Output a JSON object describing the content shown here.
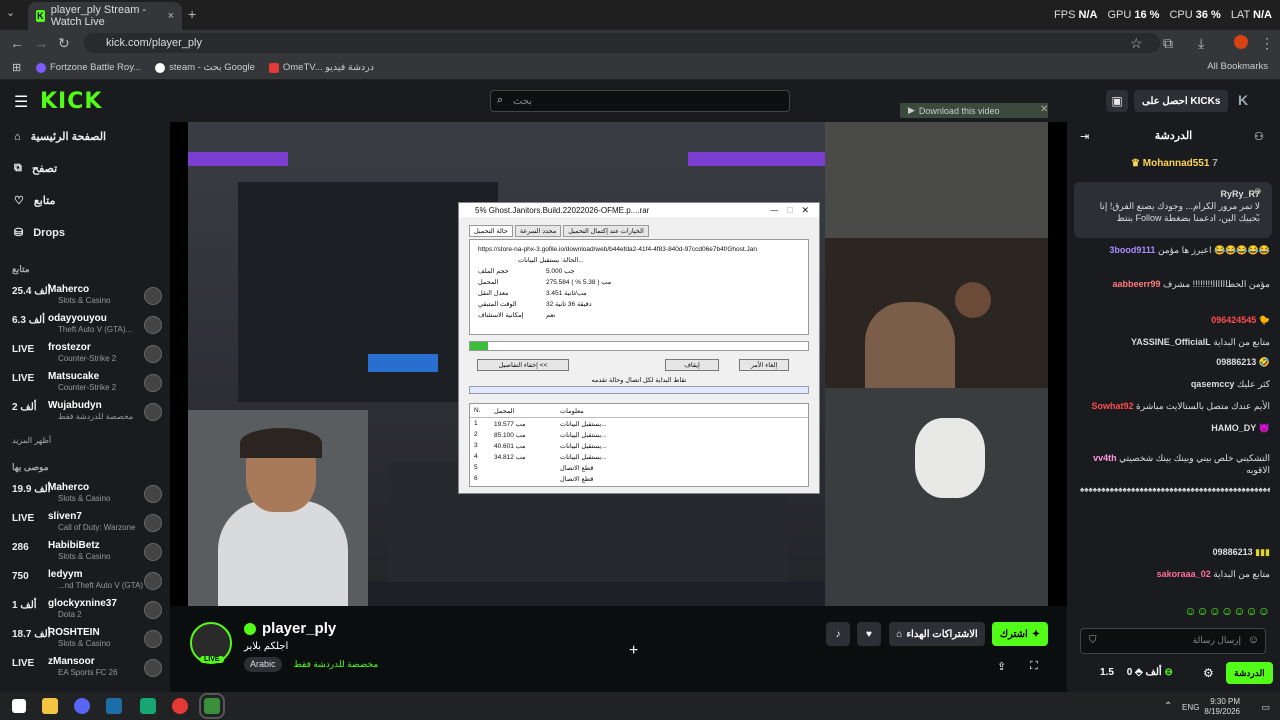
{
  "browser": {
    "tab_title": "player_ply Stream - Watch Live",
    "tab_close": "×",
    "new_tab": "+",
    "url": "kick.com/player_ply",
    "bookmarks": [
      {
        "label": "Fortzone Battle Roy...",
        "color": "#7b5cff"
      },
      {
        "label": "steam - بحث Google",
        "color": "#ffffff"
      },
      {
        "label": "OmeTV... دردشة فيديو",
        "color": "#e53935"
      }
    ],
    "all_bookmarks": "All Bookmarks"
  },
  "overlay": {
    "fps_label": "FPS",
    "fps_value": "N/A",
    "gpu_label": "GPU",
    "gpu_value": "16 %",
    "cpu_label": "CPU",
    "cpu_value": "36 %",
    "lat_label": "LAT",
    "lat_value": "N/A"
  },
  "header": {
    "logo": "KICK",
    "search_placeholder": "بحث",
    "get_kicks": "احصل على KICKs"
  },
  "sidebar": {
    "nav": [
      {
        "label": "الصفحة الرئيسية",
        "icon": "home-icon"
      },
      {
        "label": "تصفح",
        "icon": "browse-icon"
      },
      {
        "label": "متابع",
        "icon": "heart-icon"
      },
      {
        "label": "Drops",
        "icon": "drops-icon"
      }
    ],
    "following_header": "متابع",
    "following": [
      {
        "viewers": "25.4 ألف",
        "name": "Maherco",
        "category": "Slots & Casino"
      },
      {
        "viewers": "6.3 ألف",
        "name": "odayyouyou",
        "category": "Theft Auto V (GTA)..."
      },
      {
        "viewers": "LIVE",
        "name": "frostezor",
        "category": "Counter-Strike 2"
      },
      {
        "viewers": "LIVE",
        "name": "Matsucake",
        "category": "Counter-Strike 2"
      },
      {
        "viewers": "2 ألف",
        "name": "Wujabudyn",
        "category": "مخصصة للدردشة فقط"
      }
    ],
    "show_more": "أظهر المزيد",
    "recommended_header": "موصى بها",
    "recommended": [
      {
        "viewers": "19.9 ألف",
        "name": "Maherco",
        "category": "Slots & Casino"
      },
      {
        "viewers": "LIVE",
        "name": "sliven7",
        "category": "Call of Duty: Warzone"
      },
      {
        "viewers": "286",
        "name": "HabibiBetz",
        "category": "Slots & Casino"
      },
      {
        "viewers": "750",
        "name": "ledyym",
        "category": "...nd Theft Auto V (GTA)"
      },
      {
        "viewers": "1 ألف",
        "name": "glockyxnine37",
        "category": "Dota 2"
      },
      {
        "viewers": "18.7 ألف",
        "name": "ROSHTEIN",
        "category": "Slots & Casino"
      },
      {
        "viewers": "LIVE",
        "name": "zMansoor",
        "category": "EA Sports FC 26"
      }
    ]
  },
  "video": {
    "download_bar": "Download this video",
    "idm": {
      "title": "5% Ghost.Janitors.Build.22022026-OFME.p....rar",
      "tabs": [
        "حالة التحميل",
        "محدد السرعة",
        "الخيارات عند إكتمال التحميل"
      ],
      "url": "https://store-na-phx-3.gofile.io/download/web/b44efda2-41f4-4f83-840d-97ccd06e7b4f/Ghost.Jan",
      "status_label": "الحالة:",
      "status_value": "يستقبل البيانات...",
      "rows": [
        {
          "label": "حجم الملف",
          "value": "5.000 جب"
        },
        {
          "label": "المحمل",
          "value": "275.584 مب ( 5.38 % )"
        },
        {
          "label": "معدل النقل",
          "value": "3.451 مب/ثانية"
        },
        {
          "label": "الوقت المتبقي",
          "value": "32 دقيقة 36 ثانية"
        },
        {
          "label": "إمكانية الاستئناف",
          "value": "نعم"
        }
      ],
      "progress_percent": 5.38,
      "btn_hide": "إخفاء التفاصيل <<",
      "btn_pause": "إيقاف",
      "btn_cancel": "إلغاء الأمر",
      "segments_label": "نقاط البداية لكل اتصال وحالة تقدمه",
      "grid_headers": [
        "N.",
        "المحمل",
        "معلومات"
      ],
      "grid_rows": [
        [
          "1",
          "19.577 مب",
          "يستقبل البيانات..."
        ],
        [
          "2",
          "85.100 مب",
          "يستقبل البيانات..."
        ],
        [
          "3",
          "40.601 مب",
          "يستقبل البيانات..."
        ],
        [
          "4",
          "34.812 مب",
          "يستقبل البيانات..."
        ],
        [
          "5",
          "",
          "قطع الاتصال"
        ],
        [
          "6",
          "",
          "قطع الاتصال"
        ]
      ]
    }
  },
  "streamer": {
    "name": "player_ply",
    "title": "اجلكم بلاير",
    "live": "LIVE",
    "category": "مخصصة للدردشة فقط",
    "language": "Arabic",
    "subscribe": "اشترك",
    "gift": "الاشتراكات الهداء"
  },
  "chat": {
    "header": "الدردشة",
    "pinned_user": "Mohannad551",
    "pinned_count": "7",
    "messages": [
      {
        "user": "RyRy_R7",
        "text": "لا تمر مرور الكرام... وجودك يصنع الفرق! إنا بنتظ Follow بحبيك الين، ادعمنا بضغطة",
        "color": "#ffffff"
      },
      {
        "user": "3bood9111",
        "text": "اعيرز ها مؤمن 😂😂😂😂😂",
        "color": "#a98cff"
      },
      {
        "user": "aabbeerr99",
        "text": "مؤمن الحطاااااا!!!!!!!! مشرف",
        "color": "#ff7a7a"
      },
      {
        "user": "096424545",
        "text": "",
        "color": "#ff4d4d"
      },
      {
        "user": "YASSINE_OfficialL",
        "text": "متابع من البداية",
        "color": "#ffffff"
      },
      {
        "user": "09886213",
        "text": "",
        "color": "#ffffff"
      },
      {
        "user": "qasemccy",
        "text": "كثر عليك",
        "color": "#ffffff"
      },
      {
        "user": "Sowhat92",
        "text": "الأيم عندك متصل بالستالايت مباشرة",
        "color": "#ff4d4d"
      },
      {
        "user": "HAMO_DY",
        "text": "",
        "color": "#ffffff"
      },
      {
        "user": "vv4th",
        "text": "التشكيني خلص بيني وبينك بينك شخصيتي الاقويه",
        "color": "#ff9adf"
      },
      {
        "user": "09886213",
        "text": "",
        "color": "#ffffff"
      },
      {
        "user": "sakoraaa_02",
        "text": "متابع من البداية",
        "color": "#ff6f9a"
      }
    ],
    "input_placeholder": "إرسال رسالة",
    "points": "1.5 ألف",
    "zero": "0",
    "chat_button": "الدردشة"
  },
  "taskbar": {
    "lang": "ENG",
    "time": "9:30 PM",
    "date": "8/19/2026"
  }
}
